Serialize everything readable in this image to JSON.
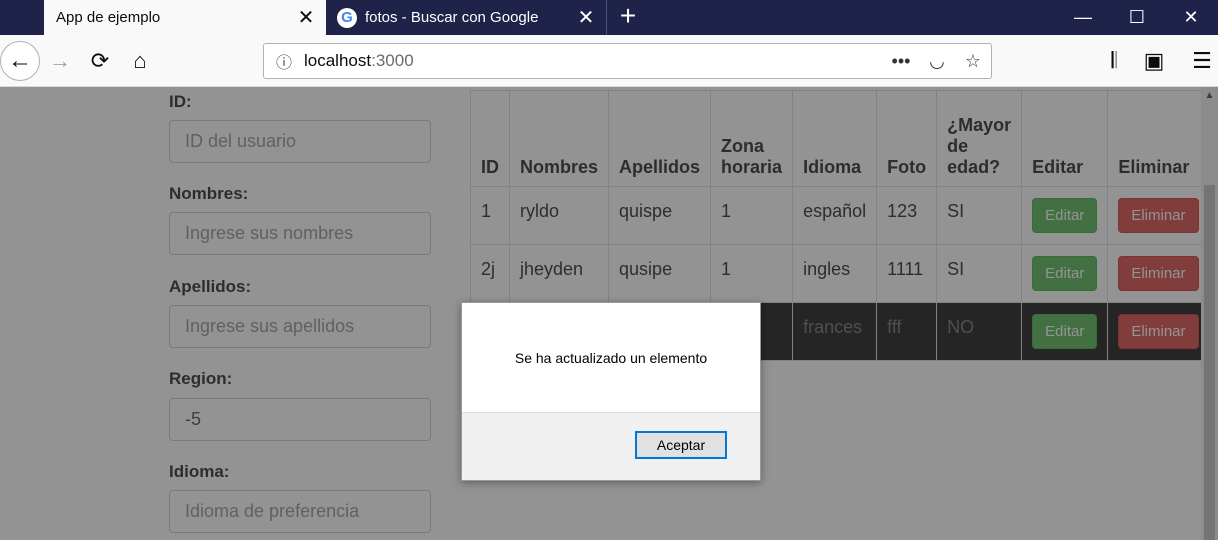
{
  "browser": {
    "tabs": [
      {
        "label": "App de ejemplo",
        "active": true
      },
      {
        "label": "fotos - Buscar con Google",
        "active": false
      }
    ],
    "new_tab_symbol": "+",
    "url_host": "localhost",
    "url_port": ":3000",
    "icons": {
      "back": "←",
      "forward": "→",
      "reload": "⟳",
      "home": "⌂",
      "info": "ⓘ",
      "more": "•••",
      "pocket": "◡",
      "star": "☆",
      "library": "𝄃",
      "sidebar": "▣",
      "menu": "☰",
      "close": "✕",
      "minimize": "—",
      "maximize": "☐",
      "google": "G"
    }
  },
  "form": {
    "id": {
      "label": "ID:",
      "placeholder": "ID del usuario",
      "value": ""
    },
    "nombres": {
      "label": "Nombres:",
      "placeholder": "Ingrese sus nombres",
      "value": ""
    },
    "apellidos": {
      "label": "Apellidos:",
      "placeholder": "Ingrese sus apellidos",
      "value": ""
    },
    "region": {
      "label": "Region:",
      "placeholder": "",
      "value": "-5"
    },
    "idioma": {
      "label": "Idioma:",
      "placeholder": "Idioma de preferencia",
      "value": ""
    }
  },
  "table": {
    "headers": [
      "ID",
      "Nombres",
      "Apellidos",
      "Zona horaria",
      "Idioma",
      "Foto",
      "¿Mayor de edad?",
      "Editar",
      "Eliminar"
    ],
    "rows": [
      {
        "id": "1",
        "nombres": "ryldo",
        "apellidos": "quispe",
        "zona": "1",
        "idioma": "español",
        "foto": "123",
        "mayor": "SI"
      },
      {
        "id": "2j",
        "nombres": "jheyden",
        "apellidos": "qusipe",
        "zona": "1",
        "idioma": "ingles",
        "foto": "1111",
        "mayor": "SI"
      },
      {
        "id": "",
        "nombres": "",
        "apellidos": "",
        "zona": "",
        "idioma": "frances",
        "foto": "fff",
        "mayor": "NO"
      }
    ],
    "edit_label": "Editar",
    "delete_label": "Eliminar"
  },
  "dialog": {
    "message": "Se ha actualizado un elemento",
    "ok_label": "Aceptar"
  },
  "colors": {
    "tabbar": "#1f2249",
    "success": "#5cb85c",
    "danger": "#d9534f",
    "dialog_focus": "#0078d7"
  }
}
